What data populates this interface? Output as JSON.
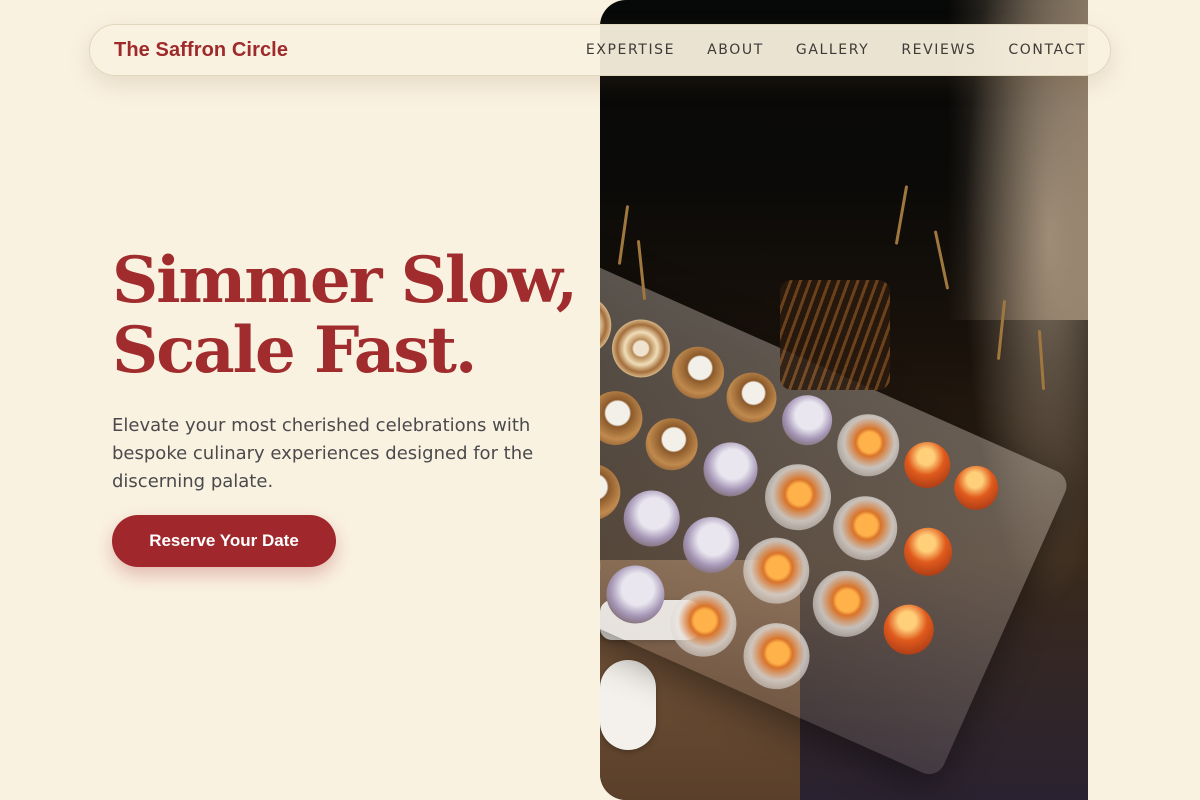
{
  "brand": {
    "name": "The Saffron Circle"
  },
  "nav": {
    "links": [
      {
        "label": "EXPERTISE"
      },
      {
        "label": "ABOUT"
      },
      {
        "label": "GALLERY"
      },
      {
        "label": "REVIEWS"
      },
      {
        "label": "CONTACT"
      }
    ]
  },
  "hero": {
    "headline_line1": "Simmer Slow,",
    "headline_line2": "Scale Fast.",
    "lead": "Elevate your most cherished celebrations with bespoke culinary experiences designed for the discerning palate.",
    "cta_label": "Reserve Your Date",
    "image_alt": "Tray of assorted catered canapés and appetizers"
  },
  "colors": {
    "background": "#faf2e1",
    "brand_red": "#a12c2e",
    "text_gray": "#4a4a4d",
    "nav_text": "#3e3a36"
  }
}
